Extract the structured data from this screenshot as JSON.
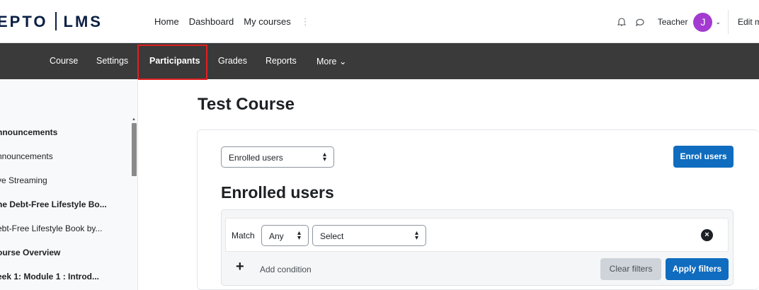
{
  "brand": {
    "left": "EPTO",
    "right": "LMS"
  },
  "topnav": {
    "home": "Home",
    "dashboard": "Dashboard",
    "mycourses": "My courses",
    "more": "⋮"
  },
  "user": {
    "role": "Teacher",
    "initial": "J",
    "edit": "Edit mode"
  },
  "secondary_nav": {
    "course": "Course",
    "settings": "Settings",
    "participants": "Participants",
    "grades": "Grades",
    "reports": "Reports",
    "more": "More ⌄"
  },
  "drawer": {
    "items": [
      "nnouncements",
      "nnouncements",
      "ve Streaming",
      "he Debt-Free Lifestyle Bo...",
      "ebt-Free Lifestyle Book by...",
      "ourse Overview",
      "eek 1: Module 1 : Introd..."
    ]
  },
  "main": {
    "page_title": "Test Course",
    "enrol_select": "Enrolled users",
    "enrol_button": "Enrol users",
    "section_title": "Enrolled users",
    "filters": {
      "match_label": "Match",
      "match_value": "Any",
      "field_value": "Select",
      "add_condition": "Add condition",
      "clear_filters": "Clear filters",
      "apply_filters": "Apply filters"
    }
  },
  "colors": {
    "primary": "#0f6cbf",
    "secondary_nav_bg": "#3a3a3a",
    "highlight": "#e02020",
    "avatar": "#a33bd0"
  }
}
